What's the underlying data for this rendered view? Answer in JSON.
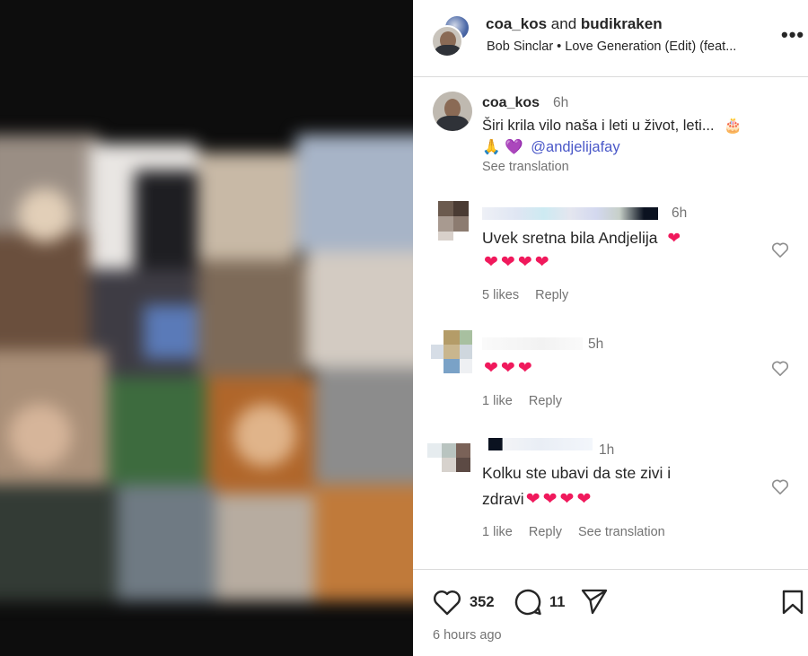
{
  "header": {
    "user1": "coa_kos",
    "connector": "and",
    "user2": "budikraken",
    "audio": "Bob Sinclar • Love Generation (Edit) (feat...",
    "more_label": "•••"
  },
  "caption": {
    "username": "coa_kos",
    "time": "6h",
    "text": "Širi krila vilo naša i leti u život, leti...",
    "cake_emoji": "🎂",
    "pray_emoji": "🙏",
    "heart_emoji": "💜",
    "mention": "@andjelijafay",
    "see_translation": "See translation"
  },
  "comments": [
    {
      "time": "6h",
      "text": "Uvek sretna bila Andjelija",
      "hearts_inline": "❤",
      "hearts": "❤❤❤❤",
      "likes": "5 likes",
      "reply": "Reply"
    },
    {
      "time": "5h",
      "text": "",
      "hearts": "❤❤❤",
      "likes": "1 like",
      "reply": "Reply"
    },
    {
      "time": "1h",
      "text": "Kolku ste ubavi da ste zivi i",
      "text2": "zdravi",
      "hearts": "❤❤❤❤",
      "likes": "1 like",
      "reply": "Reply",
      "see_translation": "See translation"
    }
  ],
  "actions": {
    "like_count": "352",
    "comment_count": "11",
    "time_ago": "6 hours ago"
  },
  "colors": {
    "mention": "#4a58c8",
    "heart": "#f0195c",
    "secondary_text": "#737373"
  }
}
